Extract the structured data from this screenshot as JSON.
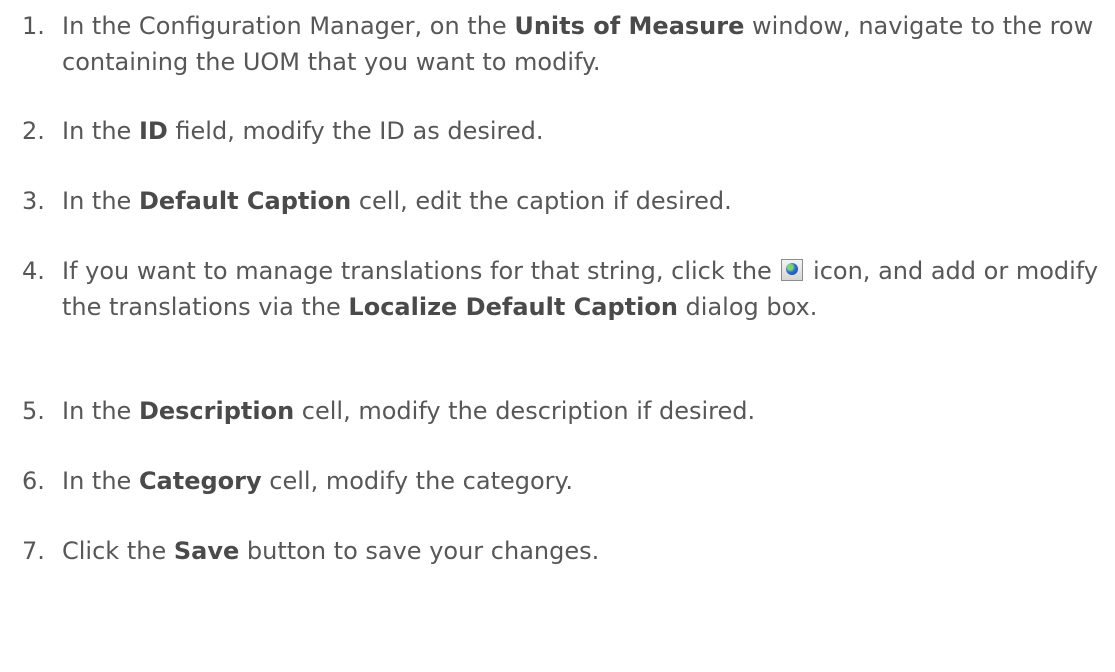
{
  "steps": [
    {
      "number": "1.",
      "text_before": "In the Configuration Manager, on the ",
      "bold_1": "Units of Measure",
      "text_after": " window, navigate to the row containing the UOM that you want to modify."
    },
    {
      "number": "2.",
      "text_before": "In the ",
      "bold_1": "ID",
      "text_after": " field, modify the ID as desired."
    },
    {
      "number": "3.",
      "text_before": "In the ",
      "bold_1": "Default Caption",
      "text_after": " cell, edit the caption if desired."
    },
    {
      "number": "4.",
      "text_before": "If you want to manage translations for that string, click the ",
      "icon": "globe-icon",
      "text_middle": " icon, and add or modify the translations via the ",
      "bold_1": "Localize Default Caption",
      "text_after": " dialog box."
    },
    {
      "number": "5.",
      "text_before": "In the ",
      "bold_1": "Description",
      "text_after": " cell, modify the description if desired."
    },
    {
      "number": "6.",
      "text_before": "In the ",
      "bold_1": "Category",
      "text_after": " cell, modify the category."
    },
    {
      "number": "7.",
      "text_before": "Click the ",
      "bold_1": "Save",
      "text_after": " button to save your changes."
    }
  ]
}
